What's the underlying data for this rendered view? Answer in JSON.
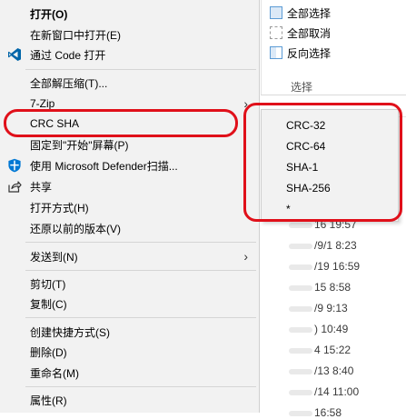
{
  "ribbon": {
    "select_all": "全部选择",
    "select_none": "全部取消",
    "invert_selection": "反向选择",
    "group_label": "选择"
  },
  "file_dates": [
    "16 19:57",
    "/9/1 8:23",
    "/19 16:59",
    "15 8:58",
    "/9 9:13",
    ") 10:49",
    "4 15:22",
    "/13 8:40",
    "/14 11:00",
    "16:58"
  ],
  "menu": {
    "open": "打开(O)",
    "open_new_window": "在新窗口中打开(E)",
    "open_with_code": "通过 Code 打开",
    "extract_all": "全部解压缩(T)...",
    "seven_zip": "7-Zip",
    "crc_sha": "CRC SHA",
    "pin_start": "固定到\"开始\"屏幕(P)",
    "defender": "使用 Microsoft Defender扫描...",
    "share": "共享",
    "open_with": "打开方式(H)",
    "restore": "还原以前的版本(V)",
    "send_to": "发送到(N)",
    "cut": "剪切(T)",
    "copy": "复制(C)",
    "create_shortcut": "创建快捷方式(S)",
    "delete": "删除(D)",
    "rename": "重命名(M)",
    "properties": "属性(R)"
  },
  "submenu": {
    "items": [
      "CRC-32",
      "CRC-64",
      "SHA-1",
      "SHA-256",
      "*"
    ]
  },
  "colors": {
    "highlight": "#e0101a",
    "menu_bg": "#f2f2f2",
    "vscode_blue": "#0065a9",
    "defender_blue": "#0078d4"
  },
  "icons": [
    "vscode-icon",
    "defender-shield-icon",
    "share-icon",
    "chevron-right-icon"
  ]
}
